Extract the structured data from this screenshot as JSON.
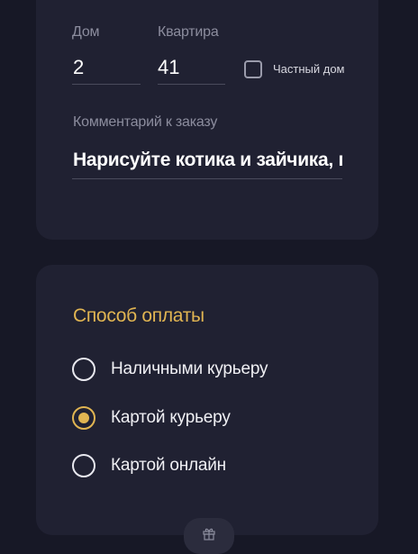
{
  "address": {
    "house": {
      "label": "Дом",
      "value": "2"
    },
    "apartment": {
      "label": "Квартира",
      "value": "41"
    },
    "private_house": {
      "label": "Частный дом",
      "checked": false
    },
    "comment": {
      "label": "Комментарий к заказу",
      "value": "Нарисуйте котика и зайчика, г"
    }
  },
  "payment": {
    "title": "Способ оплаты",
    "options": [
      {
        "label": "Наличными курьеру",
        "selected": false
      },
      {
        "label": "Картой курьеру",
        "selected": true
      },
      {
        "label": "Картой онлайн",
        "selected": false
      }
    ]
  },
  "bottom_tab": {
    "icon": "gift-icon"
  },
  "colors": {
    "background": "#171826",
    "card": "#202132",
    "accent": "#e1b552",
    "muted_text": "#8c8d9e"
  }
}
